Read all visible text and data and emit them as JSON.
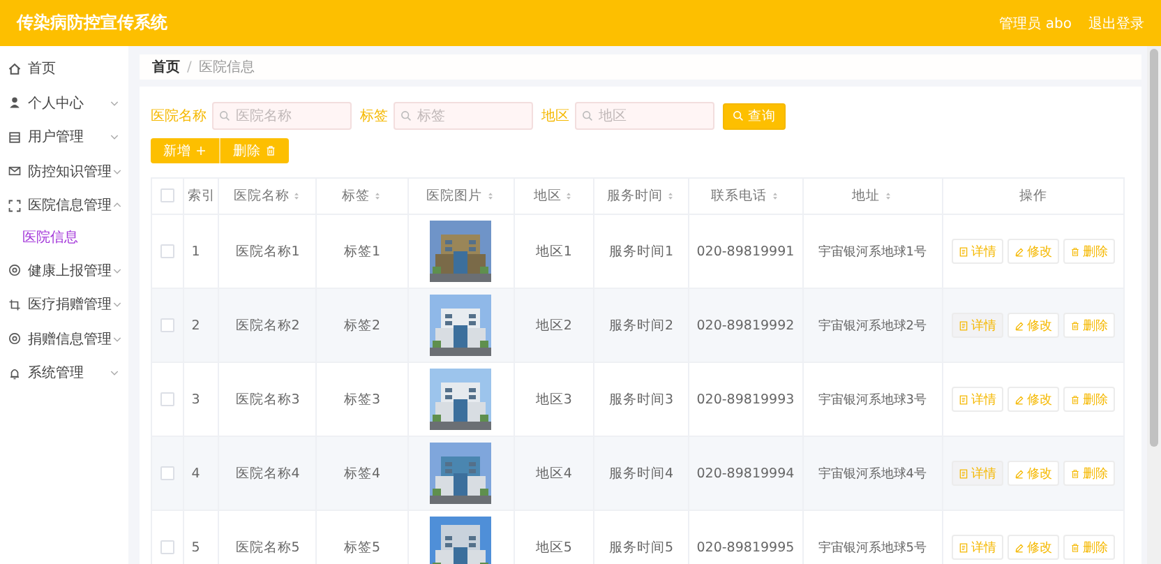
{
  "header": {
    "title": "传染病防控宣传系统",
    "user": "管理员 abo",
    "logout": "退出登录"
  },
  "sidebar": {
    "items": [
      {
        "label": "首页",
        "kind": "link"
      },
      {
        "label": "个人中心",
        "kind": "menu",
        "expanded": false
      },
      {
        "label": "用户管理",
        "kind": "menu",
        "expanded": false
      },
      {
        "label": "防控知识管理",
        "kind": "menu",
        "expanded": false
      },
      {
        "label": "医院信息管理",
        "kind": "menu",
        "expanded": true,
        "children": [
          {
            "label": "医院信息",
            "selected": true
          }
        ]
      },
      {
        "label": "健康上报管理",
        "kind": "menu",
        "expanded": false
      },
      {
        "label": "医疗捐赠管理",
        "kind": "menu",
        "expanded": false
      },
      {
        "label": "捐赠信息管理",
        "kind": "menu",
        "expanded": false
      },
      {
        "label": "系统管理",
        "kind": "menu",
        "expanded": false
      }
    ]
  },
  "breadcrumb": {
    "items": [
      "首页",
      "医院信息"
    ],
    "separator": "/"
  },
  "search": {
    "fields": [
      {
        "label": "医院名称",
        "placeholder": "医院名称"
      },
      {
        "label": "标签",
        "placeholder": "标签"
      },
      {
        "label": "地区",
        "placeholder": "地区"
      }
    ],
    "button": "查询"
  },
  "actions": [
    "新增",
    "删除"
  ],
  "table": {
    "header_checked": false,
    "columns": [
      {
        "label": "索引",
        "sortable": false
      },
      {
        "label": "医院名称",
        "sortable": true
      },
      {
        "label": "标签",
        "sortable": true
      },
      {
        "label": "医院图片",
        "sortable": true
      },
      {
        "label": "地区",
        "sortable": true
      },
      {
        "label": "服务时间",
        "sortable": true
      },
      {
        "label": "联系电话",
        "sortable": true
      },
      {
        "label": "地址",
        "sortable": true
      },
      {
        "label": "操作",
        "sortable": false
      }
    ],
    "rows": [
      {
        "checked": false,
        "cells": [
          "1",
          "医院名称1",
          "标签1",
          "",
          "地区1",
          "服务时间1",
          "020-89819991",
          "宇宙银河系地球1号"
        ],
        "buttons": [
          "详情",
          "修改",
          "删除"
        ]
      },
      {
        "checked": false,
        "cells": [
          "2",
          "医院名称2",
          "标签2",
          "",
          "地区2",
          "服务时间2",
          "020-89819992",
          "宇宙银河系地球2号"
        ],
        "buttons": [
          "详情",
          "修改",
          "删除"
        ]
      },
      {
        "checked": false,
        "cells": [
          "3",
          "医院名称3",
          "标签3",
          "",
          "地区3",
          "服务时间3",
          "020-89819993",
          "宇宙银河系地球3号"
        ],
        "buttons": [
          "详情",
          "修改",
          "删除"
        ]
      },
      {
        "checked": false,
        "cells": [
          "4",
          "医院名称4",
          "标签4",
          "",
          "地区4",
          "服务时间4",
          "020-89819994",
          "宇宙银河系地球4号"
        ],
        "buttons": [
          "详情",
          "修改",
          "删除"
        ]
      },
      {
        "checked": false,
        "cells": [
          "5",
          "医院名称5",
          "标签5",
          "",
          "地区5",
          "服务时间5",
          "020-89819995",
          "宇宙银河系地球5号"
        ],
        "buttons": [
          "详情",
          "修改",
          "删除"
        ]
      }
    ]
  }
}
